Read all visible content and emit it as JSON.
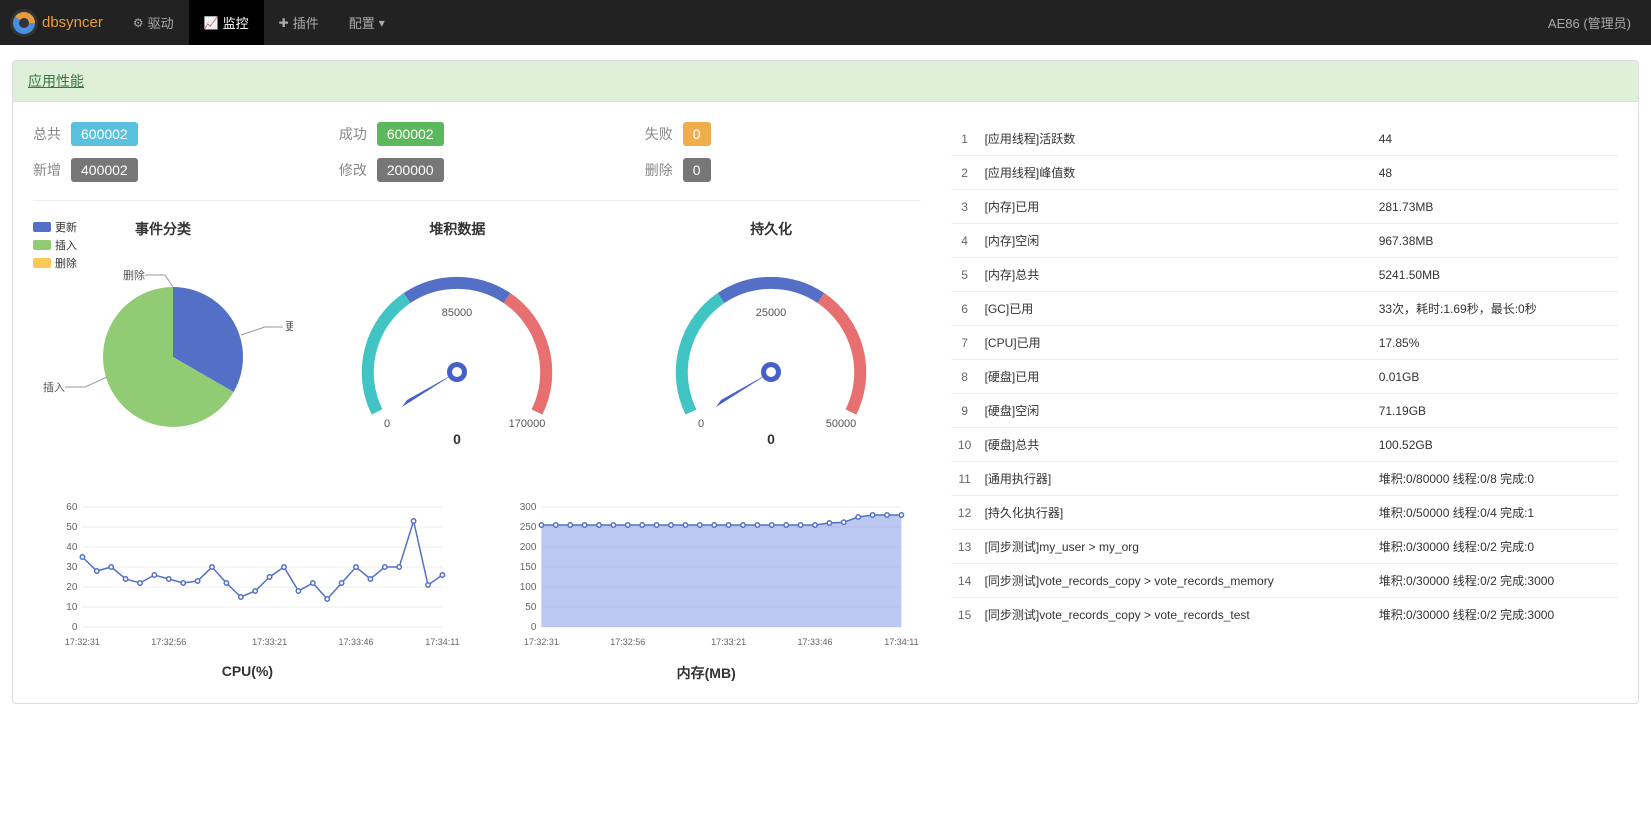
{
  "nav": {
    "logo": "dbsyncer",
    "items": [
      "驱动",
      "监控",
      "插件",
      "配置"
    ],
    "active_index": 1,
    "user": "AE86 (管理员)"
  },
  "panel": {
    "title": "应用性能"
  },
  "stats": {
    "row1": [
      {
        "label": "总共",
        "value": "600002",
        "cls": "badge-info"
      },
      {
        "label": "成功",
        "value": "600002",
        "cls": "badge-success"
      },
      {
        "label": "失败",
        "value": "0",
        "cls": "badge-warn"
      }
    ],
    "row2": [
      {
        "label": "新增",
        "value": "400002",
        "cls": "badge-gray"
      },
      {
        "label": "修改",
        "value": "200000",
        "cls": "badge-gray"
      },
      {
        "label": "删除",
        "value": "0",
        "cls": "badge-gray"
      }
    ]
  },
  "pie": {
    "title": "事件分类",
    "legend": [
      {
        "label": "更新",
        "color": "#5470c6"
      },
      {
        "label": "插入",
        "color": "#91cc75"
      },
      {
        "label": "删除",
        "color": "#fac858"
      }
    ],
    "labels": {
      "update": "更新",
      "insert": "插入",
      "delete": "删除"
    }
  },
  "gauge1": {
    "title": "堆积数据",
    "min": "0",
    "mid": "85000",
    "max": "170000",
    "value": "0"
  },
  "gauge2": {
    "title": "持久化",
    "min": "0",
    "mid": "25000",
    "max": "50000",
    "value": "0"
  },
  "cpu_chart": {
    "title": "CPU(%)"
  },
  "mem_chart": {
    "title": "内存(MB)"
  },
  "table": {
    "rows": [
      {
        "n": "1",
        "k": "[应用线程]活跃数",
        "v": "44"
      },
      {
        "n": "2",
        "k": "[应用线程]峰值数",
        "v": "48"
      },
      {
        "n": "3",
        "k": "[内存]已用",
        "v": "281.73MB"
      },
      {
        "n": "4",
        "k": "[内存]空闲",
        "v": "967.38MB"
      },
      {
        "n": "5",
        "k": "[内存]总共",
        "v": "5241.50MB"
      },
      {
        "n": "6",
        "k": "[GC]已用",
        "v": "33次，耗时:1.69秒，最长:0秒"
      },
      {
        "n": "7",
        "k": "[CPU]已用",
        "v": "17.85%"
      },
      {
        "n": "8",
        "k": "[硬盘]已用",
        "v": "0.01GB"
      },
      {
        "n": "9",
        "k": "[硬盘]空闲",
        "v": "71.19GB"
      },
      {
        "n": "10",
        "k": "[硬盘]总共",
        "v": "100.52GB"
      },
      {
        "n": "11",
        "k": "[通用执行器]",
        "v": "堆积:0/80000 线程:0/8 完成:0"
      },
      {
        "n": "12",
        "k": "[持久化执行器]",
        "v": "堆积:0/50000 线程:0/4 完成:1"
      },
      {
        "n": "13",
        "k": "[同步测试]my_user > my_org",
        "v": "堆积:0/30000 线程:0/2 完成:0"
      },
      {
        "n": "14",
        "k": "[同步测试]vote_records_copy > vote_records_memory",
        "v": "堆积:0/30000 线程:0/2 完成:3000"
      },
      {
        "n": "15",
        "k": "[同步测试]vote_records_copy > vote_records_test",
        "v": "堆积:0/30000 线程:0/2 完成:3000"
      }
    ]
  },
  "chart_data": [
    {
      "type": "pie",
      "title": "事件分类",
      "series": [
        {
          "name": "更新",
          "value": 200000
        },
        {
          "name": "插入",
          "value": 400002
        },
        {
          "name": "删除",
          "value": 0
        }
      ]
    },
    {
      "type": "gauge",
      "title": "堆积数据",
      "min": 0,
      "max": 170000,
      "value": 0
    },
    {
      "type": "gauge",
      "title": "持久化",
      "min": 0,
      "max": 50000,
      "value": 0
    },
    {
      "type": "line",
      "title": "CPU(%)",
      "xlabel": "",
      "ylabel": "",
      "ylim": [
        0,
        60
      ],
      "x_ticks": [
        "17:32:31",
        "17:32:56",
        "17:33:21",
        "17:33:46",
        "17:34:11"
      ],
      "x": [
        0,
        1,
        2,
        3,
        4,
        5,
        6,
        7,
        8,
        9,
        10,
        11,
        12,
        13,
        14,
        15,
        16,
        17,
        18,
        19,
        20,
        21,
        22,
        23,
        24,
        25
      ],
      "values": [
        35,
        28,
        30,
        24,
        22,
        26,
        24,
        22,
        23,
        30,
        22,
        15,
        18,
        25,
        30,
        18,
        22,
        14,
        22,
        30,
        24,
        30,
        30,
        53,
        21,
        26
      ]
    },
    {
      "type": "area",
      "title": "内存(MB)",
      "xlabel": "",
      "ylabel": "",
      "ylim": [
        0,
        300
      ],
      "x_ticks": [
        "17:32:31",
        "17:32:56",
        "17:33:21",
        "17:33:46",
        "17:34:11"
      ],
      "x": [
        0,
        1,
        2,
        3,
        4,
        5,
        6,
        7,
        8,
        9,
        10,
        11,
        12,
        13,
        14,
        15,
        16,
        17,
        18,
        19,
        20,
        21,
        22,
        23,
        24,
        25
      ],
      "values": [
        255,
        255,
        255,
        255,
        255,
        255,
        255,
        255,
        255,
        255,
        255,
        255,
        255,
        255,
        255,
        255,
        255,
        255,
        255,
        255,
        260,
        262,
        275,
        280,
        280,
        280
      ]
    }
  ]
}
